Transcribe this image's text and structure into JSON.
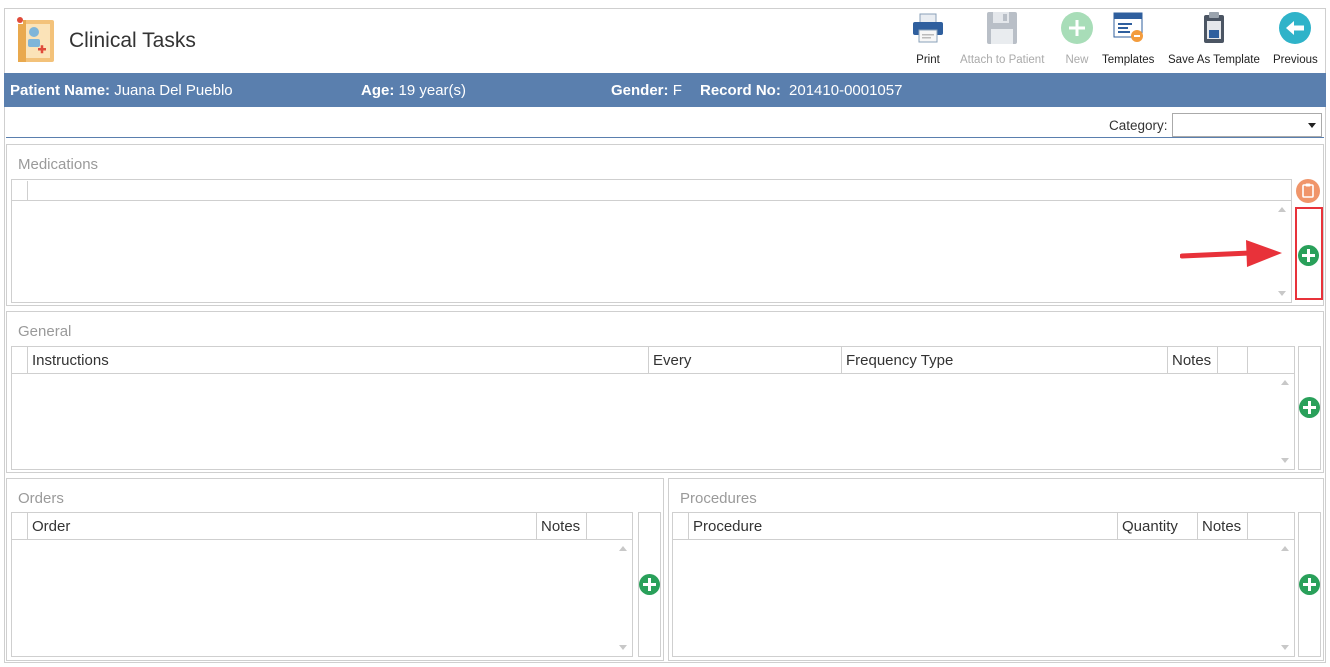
{
  "header": {
    "title": "Clinical Tasks",
    "toolbar": {
      "print": "Print",
      "attach": "Attach to Patient",
      "new": "New",
      "templates": "Templates",
      "save_template": "Save As Template",
      "previous": "Previous"
    }
  },
  "patient": {
    "name_label": "Patient Name:",
    "name": "Juana Del Pueblo",
    "age_label": "Age:",
    "age": "19 year(s)",
    "gender_label": "Gender:",
    "gender": "F",
    "record_label": "Record No:",
    "record": "201410-0001057"
  },
  "filters": {
    "category_label": "Category:",
    "category_value": ""
  },
  "sections": {
    "medications": {
      "title": "Medications"
    },
    "general": {
      "title": "General",
      "columns": [
        "Instructions",
        "Every",
        "Frequency Type",
        "Notes"
      ]
    },
    "orders": {
      "title": "Orders",
      "columns": [
        "Order",
        "Notes"
      ]
    },
    "procedures": {
      "title": "Procedures",
      "columns": [
        "Procedure",
        "Quantity",
        "Notes"
      ]
    }
  },
  "colors": {
    "patient_bar": "#5a7fae",
    "add_button": "#29a05a",
    "clipboard_button": "#f0956a",
    "highlight": "#e8323a"
  },
  "icons": {
    "app": "clinical-chart-icon",
    "print": "printer-icon",
    "attach": "floppy-disk-icon",
    "new": "plus-circle-icon",
    "templates": "template-window-icon",
    "save_template": "clipboard-save-icon",
    "previous": "arrow-left-circle-icon",
    "add": "plus-circle-icon",
    "clipboard": "clipboard-icon"
  }
}
